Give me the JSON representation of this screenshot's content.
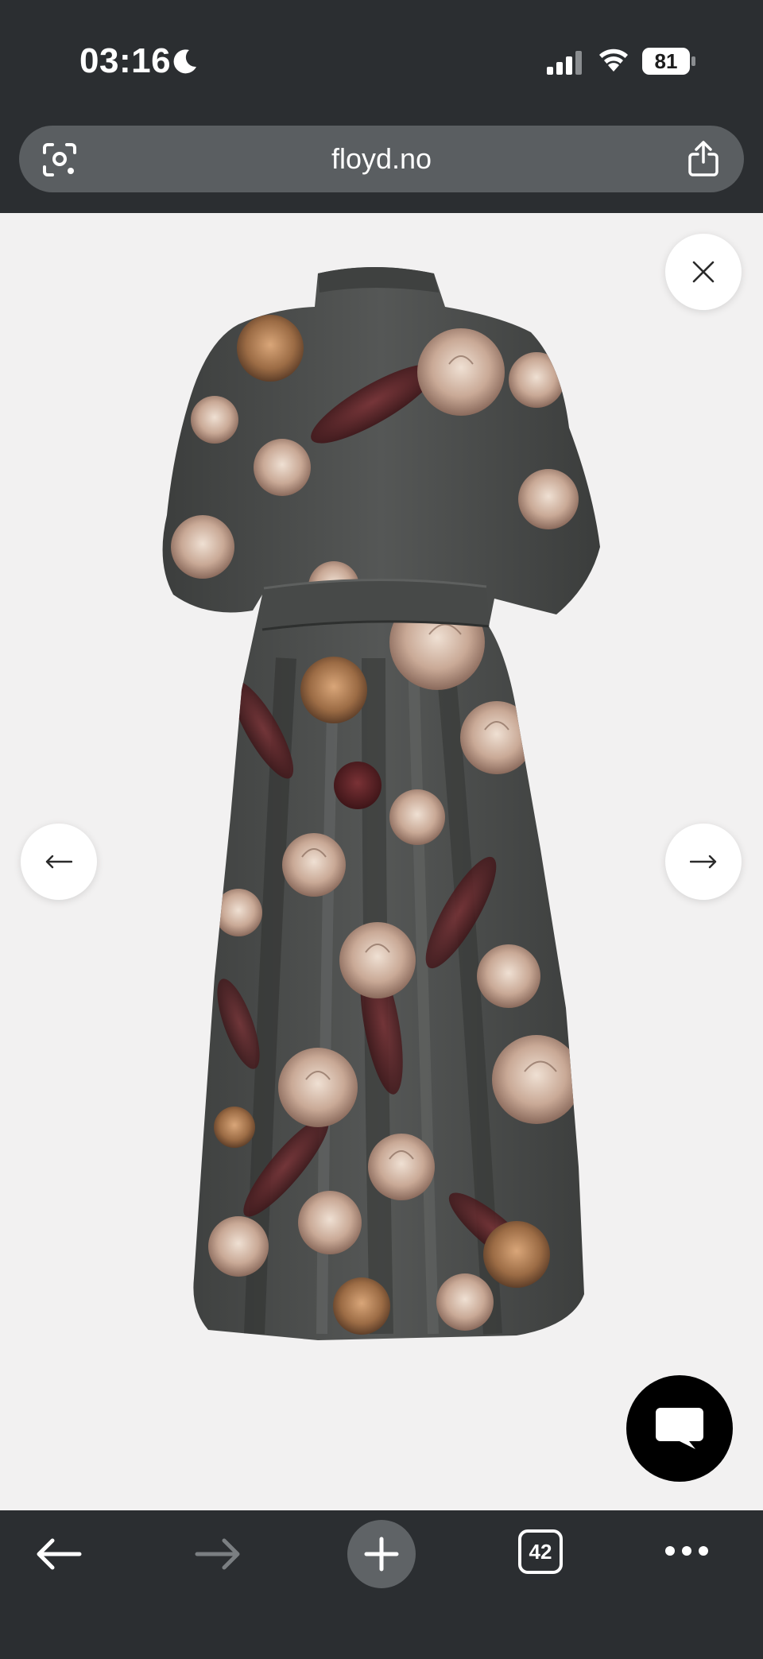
{
  "status_bar": {
    "time": "03:16",
    "battery": "81",
    "icons": [
      "moon-icon",
      "signal-icon",
      "wifi-icon",
      "battery-icon"
    ]
  },
  "address_bar": {
    "url": "floyd.no",
    "icons": [
      "lens-icon",
      "share-icon"
    ]
  },
  "gallery": {
    "image": "floral-print-maxi-dress",
    "close_icon": "close-icon",
    "prev_icon": "arrow-left-icon",
    "next_icon": "arrow-right-icon"
  },
  "chat": {
    "icon": "chat-bubble-icon"
  },
  "toolbar": {
    "tabs_count": "42",
    "icons": [
      "back-arrow-icon",
      "forward-arrow-icon",
      "plus-icon",
      "tabs-icon",
      "more-icon"
    ]
  },
  "colors": {
    "chrome": "#2b2e31",
    "address_bar": "#5a5e61",
    "page_bg": "#f2f1f1",
    "dress_base": "#4a4c4b",
    "flower_light": "#d8c2b4",
    "flower_tan": "#a9805a",
    "flower_wine": "#5e2228"
  }
}
